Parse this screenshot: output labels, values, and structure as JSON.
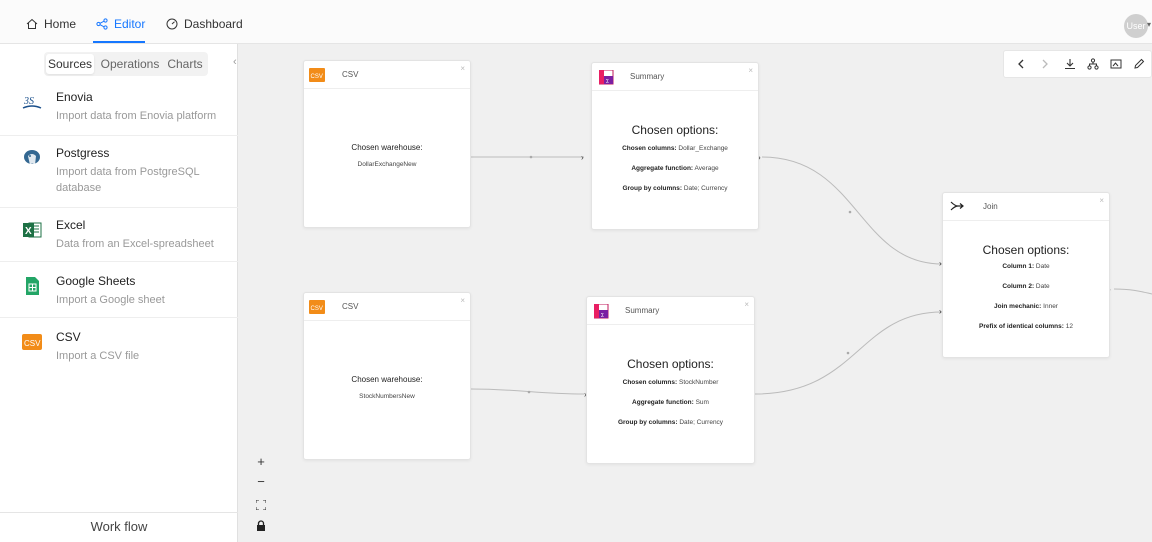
{
  "topbar": {
    "nav": [
      "Home",
      "Editor",
      "Dashboard"
    ],
    "user": "User"
  },
  "sidebar": {
    "tabs": [
      "Sources",
      "Operations",
      "Charts"
    ],
    "sources": [
      {
        "title": "Enovia",
        "desc": "Import data from Enovia platform"
      },
      {
        "title": "Postgress",
        "desc": "Import data from PostgreSQL database"
      },
      {
        "title": "Excel",
        "desc": "Data from an Excel-spreadsheet"
      },
      {
        "title": "Google Sheets",
        "desc": "Import a Google sheet"
      },
      {
        "title": "CSV",
        "desc": "Import a CSV file"
      }
    ],
    "workflow": "Work flow"
  },
  "nodes": {
    "csv1": {
      "title": "CSV",
      "icon_text": "CSV",
      "label": "Chosen warehouse:",
      "value": "DollarExchangeNew"
    },
    "csv2": {
      "title": "CSV",
      "icon_text": "CSV",
      "label": "Chosen warehouse:",
      "value": "StockNumbersNew"
    },
    "sum1": {
      "title": "Summary",
      "heading": "Chosen options:",
      "options": [
        {
          "k": "Chosen columns:",
          "v": "Dollar_Exchange"
        },
        {
          "k": "Aggregate function:",
          "v": "Average"
        },
        {
          "k": "Group by columns:",
          "v": "Date; Currency"
        }
      ]
    },
    "sum2": {
      "title": "Summary",
      "heading": "Chosen options:",
      "options": [
        {
          "k": "Chosen columns:",
          "v": "StockNumber"
        },
        {
          "k": "Aggregate function:",
          "v": "Sum"
        },
        {
          "k": "Group by columns:",
          "v": "Date; Currency"
        }
      ]
    },
    "join": {
      "title": "Join",
      "heading": "Chosen options:",
      "options": [
        {
          "k": "Column 1:",
          "v": "Date"
        },
        {
          "k": "Column 2:",
          "v": "Date"
        },
        {
          "k": "Join mechanic:",
          "v": "Inner"
        },
        {
          "k": "Prefix of identical columns:",
          "v": "12"
        }
      ]
    }
  },
  "colors": {
    "accent": "#1677ff",
    "csv_orange": "#f28c18",
    "excel_green": "#1e7145",
    "sheets_green": "#23a566"
  }
}
